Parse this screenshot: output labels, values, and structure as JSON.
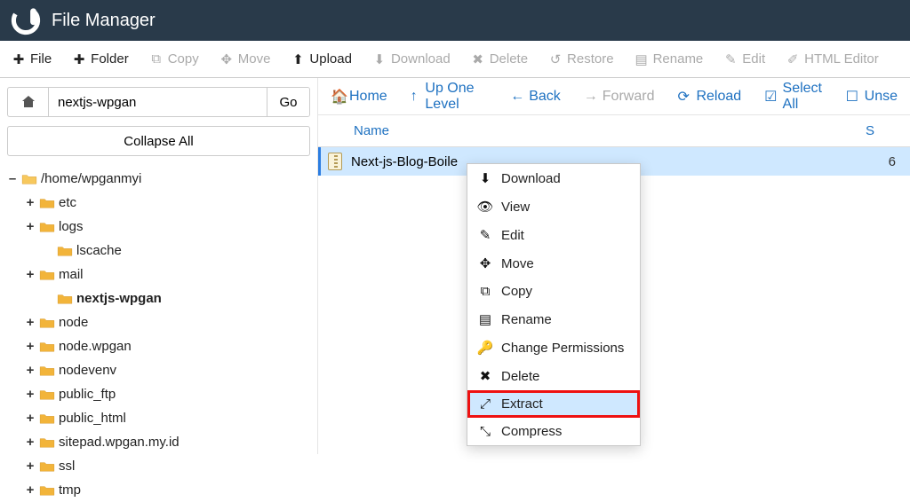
{
  "header": {
    "title": "File Manager"
  },
  "toolbar": {
    "file": "File",
    "folder": "Folder",
    "copy": "Copy",
    "move": "Move",
    "upload": "Upload",
    "download": "Download",
    "delete": "Delete",
    "restore": "Restore",
    "rename": "Rename",
    "edit": "Edit",
    "html_editor": "HTML Editor"
  },
  "path": {
    "value": "nextjs-wpgan",
    "go": "Go"
  },
  "collapse": "Collapse All",
  "tree": {
    "root": "/home/wpganmyi",
    "items": [
      {
        "label": "etc",
        "expand": "+",
        "indent": 1
      },
      {
        "label": "logs",
        "expand": "+",
        "indent": 1
      },
      {
        "label": "lscache",
        "expand": "",
        "indent": 2
      },
      {
        "label": "mail",
        "expand": "+",
        "indent": 1
      },
      {
        "label": "nextjs-wpgan",
        "expand": "",
        "indent": 2,
        "bold": true
      },
      {
        "label": "node",
        "expand": "+",
        "indent": 1
      },
      {
        "label": "node.wpgan",
        "expand": "+",
        "indent": 1
      },
      {
        "label": "nodevenv",
        "expand": "+",
        "indent": 1
      },
      {
        "label": "public_ftp",
        "expand": "+",
        "indent": 1
      },
      {
        "label": "public_html",
        "expand": "+",
        "indent": 1
      },
      {
        "label": "sitepad.wpgan.my.id",
        "expand": "+",
        "indent": 1
      },
      {
        "label": "ssl",
        "expand": "+",
        "indent": 1
      },
      {
        "label": "tmp",
        "expand": "+",
        "indent": 1
      }
    ]
  },
  "nav": {
    "home": "Home",
    "up": "Up One Level",
    "back": "Back",
    "forward": "Forward",
    "reload": "Reload",
    "select_all": "Select All",
    "unselect": "Unse"
  },
  "cols": {
    "name": "Name",
    "size": "S"
  },
  "file": {
    "name": "Next-js-Blog-Boile",
    "truncated_size": "6"
  },
  "ctx": {
    "download": "Download",
    "view": "View",
    "edit": "Edit",
    "move": "Move",
    "copy": "Copy",
    "rename": "Rename",
    "permissions": "Change Permissions",
    "delete": "Delete",
    "extract": "Extract",
    "compress": "Compress"
  }
}
